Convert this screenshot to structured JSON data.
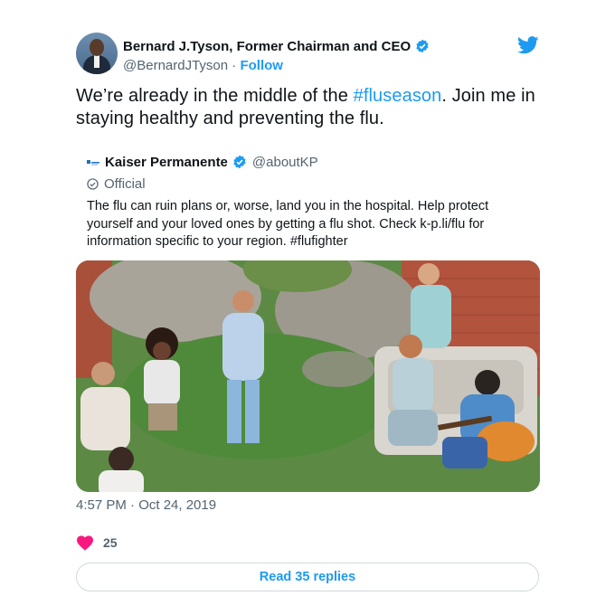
{
  "author": {
    "name": "Bernard J.Tyson, Former Chairman and CEO",
    "handle": "@BernardJTyson",
    "separator": "·",
    "follow_label": "Follow"
  },
  "tweet": {
    "text_before": "We’re already in the middle of the ",
    "hashtag": "#fluseason",
    "text_after": ". Join me in staying healthy and preventing the flu."
  },
  "quoted": {
    "name": "Kaiser Permanente",
    "handle": "@aboutKP",
    "label": "Official",
    "text": "The flu can ruin plans or, worse, land you in the hospital. Help protect yourself and your loved ones by getting a flu shot. Check k-p.li/flu for information specific to your region. #flufighter"
  },
  "timestamp": "4:57 PM · Oct 24, 2019",
  "likes": {
    "count": "25"
  },
  "replies_button": "Read 35 replies",
  "colors": {
    "accent": "#1d9bf0",
    "heart": "#f91880",
    "text": "#0f1419",
    "muted": "#536471"
  },
  "icons": [
    "verified-badge-icon",
    "twitter-bird-icon",
    "kp-logo-icon",
    "official-check-icon",
    "heart-icon"
  ]
}
